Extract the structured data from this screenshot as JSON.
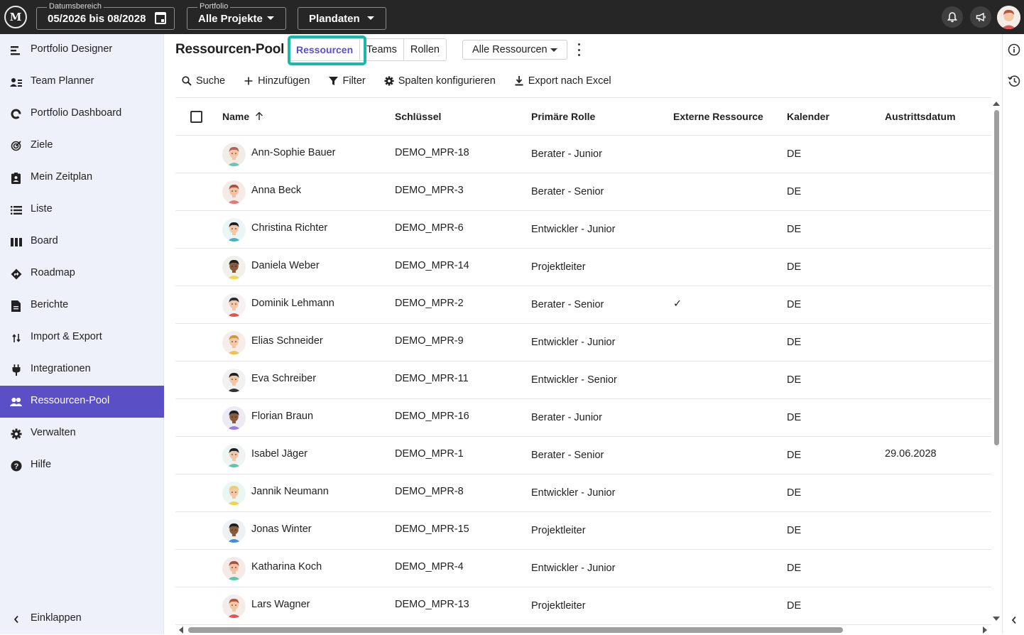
{
  "topbar": {
    "logo_text": "M",
    "date_range": {
      "caption": "Datumsbereich",
      "value": "05/2026 bis 08/2028"
    },
    "portfolio": {
      "caption": "Portfolio",
      "value": "Alle Projekte"
    },
    "plan": {
      "value": "Plandaten"
    },
    "icons": [
      "bell-icon",
      "megaphone-icon",
      "user-avatar"
    ]
  },
  "sidebar": {
    "items": [
      {
        "label": "Portfolio Designer",
        "icon": "portfolio-designer-icon"
      },
      {
        "label": "Team Planner",
        "icon": "team-planner-icon"
      },
      {
        "label": "Portfolio Dashboard",
        "icon": "dashboard-icon"
      },
      {
        "label": "Ziele",
        "icon": "target-icon"
      },
      {
        "label": "Mein Zeitplan",
        "icon": "schedule-icon"
      },
      {
        "label": "Liste",
        "icon": "list-icon"
      },
      {
        "label": "Board",
        "icon": "board-icon"
      },
      {
        "label": "Roadmap",
        "icon": "roadmap-icon"
      },
      {
        "label": "Berichte",
        "icon": "report-icon"
      },
      {
        "label": "Import & Export",
        "icon": "import-export-icon"
      },
      {
        "label": "Integrationen",
        "icon": "plug-icon"
      },
      {
        "label": "Ressourcen-Pool",
        "icon": "people-icon",
        "active": true
      },
      {
        "label": "Verwalten",
        "icon": "gear-icon"
      },
      {
        "label": "Hilfe",
        "icon": "help-icon"
      }
    ],
    "collapse_label": "Einklappen"
  },
  "main": {
    "title": "Ressourcen-Pool",
    "tabs": [
      {
        "label": "Ressourcen",
        "active": true
      },
      {
        "label": "Teams"
      },
      {
        "label": "Rollen"
      }
    ],
    "filter_dropdown": "Alle Ressourcen",
    "toolbar": {
      "search": "Suche",
      "add": "Hinzufügen",
      "filter": "Filter",
      "columns": "Spalten konfigurieren",
      "export": "Export nach Excel"
    }
  },
  "table": {
    "columns": [
      "Name",
      "Schlüssel",
      "Primäre Rolle",
      "Externe Ressource",
      "Kalender",
      "Austrittsdatum"
    ],
    "sort_column": "Name",
    "rows": [
      {
        "name": "Ann-Sophie Bauer",
        "key": "DEMO_MPR-18",
        "role": "Berater - Junior",
        "external": "",
        "calendar": "DE",
        "exit": "",
        "skin": "#f3c6a5",
        "hair": "#b5615a",
        "shirt": "#63c7b8",
        "bg": "#f1ece6"
      },
      {
        "name": "Anna Beck",
        "key": "DEMO_MPR-3",
        "role": "Berater - Senior",
        "external": "",
        "calendar": "DE",
        "exit": "",
        "skin": "#f0c0a0",
        "hair": "#a8503d",
        "shirt": "#e07a7a",
        "bg": "#f4ebe8"
      },
      {
        "name": "Christina Richter",
        "key": "DEMO_MPR-6",
        "role": "Entwickler - Junior",
        "external": "",
        "calendar": "DE",
        "exit": "",
        "skin": "#f3c6a5",
        "hair": "#1d1d1d",
        "shirt": "#3fb4c9",
        "bg": "#eaf5f7"
      },
      {
        "name": "Daniela Weber",
        "key": "DEMO_MPR-14",
        "role": "Projektleiter",
        "external": "",
        "calendar": "DE",
        "exit": "",
        "skin": "#8a5a3b",
        "hair": "#1d1d1d",
        "shirt": "#f3d64c",
        "bg": "#f2f0ea"
      },
      {
        "name": "Dominik Lehmann",
        "key": "DEMO_MPR-2",
        "role": "Berater - Senior",
        "external": "✓",
        "calendar": "DE",
        "exit": "",
        "skin": "#f3c6a5",
        "hair": "#2a2a2a",
        "shirt": "#e05555",
        "bg": "#f3f1f1"
      },
      {
        "name": "Elias Schneider",
        "key": "DEMO_MPR-9",
        "role": "Entwickler - Junior",
        "external": "",
        "calendar": "DE",
        "exit": "",
        "skin": "#f3c6a5",
        "hair": "#c79a3f",
        "shirt": "#f0c24a",
        "bg": "#f6ecea"
      },
      {
        "name": "Eva Schreiber",
        "key": "DEMO_MPR-11",
        "role": "Entwickler - Senior",
        "external": "",
        "calendar": "DE",
        "exit": "",
        "skin": "#f3c6a5",
        "hair": "#1d1d1d",
        "shirt": "#333333",
        "bg": "#f1f1f1"
      },
      {
        "name": "Florian Braun",
        "key": "DEMO_MPR-16",
        "role": "Berater - Junior",
        "external": "",
        "calendar": "DE",
        "exit": "",
        "skin": "#8a5a3b",
        "hair": "#1d1d1d",
        "shirt": "#9a7be0",
        "bg": "#eeeaf4"
      },
      {
        "name": "Isabel Jäger",
        "key": "DEMO_MPR-1",
        "role": "Berater - Senior",
        "external": "",
        "calendar": "DE",
        "exit": "29.06.2028",
        "skin": "#f3c6a5",
        "hair": "#1d1d1d",
        "shirt": "#5cc7a8",
        "bg": "#eef4f1"
      },
      {
        "name": "Jannik Neumann",
        "key": "DEMO_MPR-8",
        "role": "Entwickler - Junior",
        "external": "",
        "calendar": "DE",
        "exit": "",
        "skin": "#f3c6a5",
        "hair": "#e8d070",
        "shirt": "#f1d24d",
        "bg": "#eaf6f0"
      },
      {
        "name": "Jonas Winter",
        "key": "DEMO_MPR-15",
        "role": "Projektleiter",
        "external": "",
        "calendar": "DE",
        "exit": "",
        "skin": "#8a5a3b",
        "hair": "#1d1d1d",
        "shirt": "#3f8fd8",
        "bg": "#eef1f4"
      },
      {
        "name": "Katharina Koch",
        "key": "DEMO_MPR-4",
        "role": "Entwickler - Junior",
        "external": "",
        "calendar": "DE",
        "exit": "",
        "skin": "#f0c0a0",
        "hair": "#a8503d",
        "shirt": "#5cc7a8",
        "bg": "#f4ebe8"
      },
      {
        "name": "Lars Wagner",
        "key": "DEMO_MPR-13",
        "role": "Projektleiter",
        "external": "",
        "calendar": "DE",
        "exit": "",
        "skin": "#f3c6a5",
        "hair": "#b3573a",
        "shirt": "#e05555",
        "bg": "#f4ece8"
      }
    ]
  },
  "colors": {
    "topbar_bg": "#262626",
    "sidebar_bg": "#eef0fa",
    "accent": "#5a4fc4",
    "focus_ring": "#1bb8aa"
  }
}
